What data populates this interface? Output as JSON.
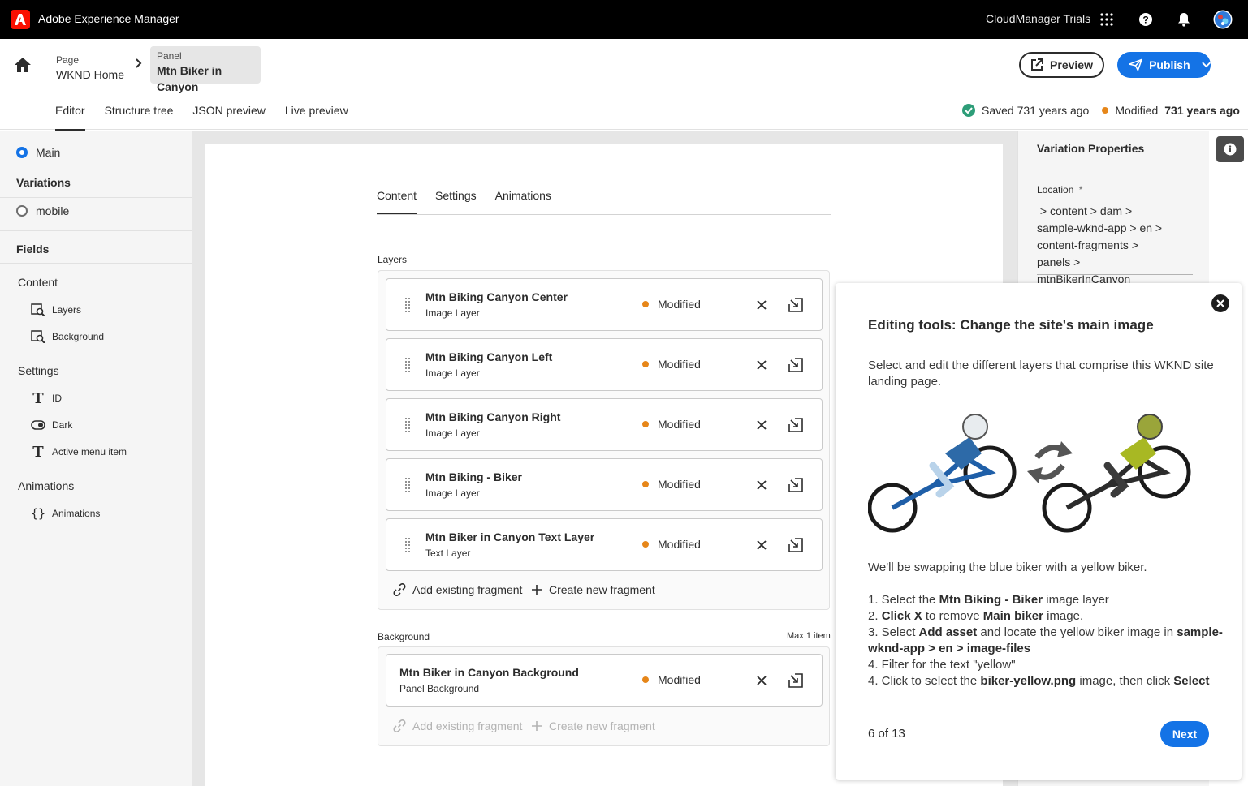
{
  "topbar": {
    "app_title": "Adobe Experience Manager",
    "org_name": "CloudManager Trials"
  },
  "header": {
    "breadcrumbs": [
      {
        "kind": "Page",
        "value": "WKND Home"
      },
      {
        "kind": "Panel",
        "value": "Mtn Biker in Canyon"
      }
    ],
    "preview_label": "Preview",
    "publish_label": "Publish",
    "tabs": [
      "Editor",
      "Structure tree",
      "JSON preview",
      "Live preview"
    ],
    "saved_text": "Saved 731 years ago",
    "modified_label": "Modified",
    "modified_value": "731 years ago"
  },
  "left": {
    "main_label": "Main",
    "variations_title": "Variations",
    "variation_mobile": "mobile",
    "fields_title": "Fields",
    "groups": {
      "content": "Content",
      "settings": "Settings",
      "animations": "Animations"
    },
    "fields": {
      "layers": "Layers",
      "background": "Background",
      "id": "ID",
      "dark": "Dark",
      "active_menu_item": "Active menu item",
      "animations": "Animations"
    }
  },
  "editor": {
    "tabs": [
      "Content",
      "Settings",
      "Animations"
    ],
    "layers_label": "Layers",
    "layers": [
      {
        "title": "Mtn Biking Canyon Center",
        "sub": "Image Layer",
        "status": "Modified"
      },
      {
        "title": "Mtn Biking Canyon Left",
        "sub": "Image Layer",
        "status": "Modified"
      },
      {
        "title": "Mtn Biking Canyon Right",
        "sub": "Image Layer",
        "status": "Modified"
      },
      {
        "title": "Mtn Biking - Biker",
        "sub": "Image Layer",
        "status": "Modified"
      },
      {
        "title": "Mtn Biker in Canyon Text Layer",
        "sub": "Text Layer",
        "status": "Modified"
      }
    ],
    "add_existing": "Add existing fragment",
    "create_new": "Create new fragment",
    "background_label": "Background",
    "background_max": "Max 1 item",
    "background_item": {
      "title": "Mtn Biker in Canyon Background",
      "sub": "Panel Background",
      "status": "Modified"
    }
  },
  "right": {
    "title": "Variation Properties",
    "location_label": "Location",
    "required_mark": "*",
    "location_path": " > content > dam > sample-wknd-app > en > content-fragments > panels > mtnBikerInCanyon"
  },
  "tour": {
    "title": "Editing tools: Change the site's main image",
    "intro": "Select and edit the different layers that comprise this WKND site landing page.",
    "swap_text": "We'll be swapping the blue biker with a yellow biker.",
    "steps": [
      {
        "pre": "1. Select the ",
        "b1": "Mtn Biking - Biker",
        "mid": " image layer",
        "b2": "",
        "post": ""
      },
      {
        "pre": "2. ",
        "b1": "Click X",
        "mid": " to remove ",
        "b2": "Main biker",
        "post": " image."
      },
      {
        "pre": "3. Select ",
        "b1": "Add asset",
        "mid": " and locate the yellow biker image in ",
        "b2": "sample-wknd-app > en > image-files",
        "post": ""
      },
      {
        "pre": "4. Filter for the text \"yellow\"",
        "b1": "",
        "mid": "",
        "b2": "",
        "post": ""
      },
      {
        "pre": "4. Click to select the ",
        "b1": "biker-yellow.png",
        "mid": " image, then click ",
        "b2": "Select",
        "post": ""
      }
    ],
    "counter": "6 of 13",
    "next_label": "Next",
    "bike_colors": {
      "blue": "#1f5fa8",
      "yellow": "#a8b823"
    }
  },
  "colors": {
    "accent": "#1473e6",
    "modified_dot": "#e68619",
    "saved_check": "#2d9d78",
    "adobe_red": "#fa0f00"
  }
}
